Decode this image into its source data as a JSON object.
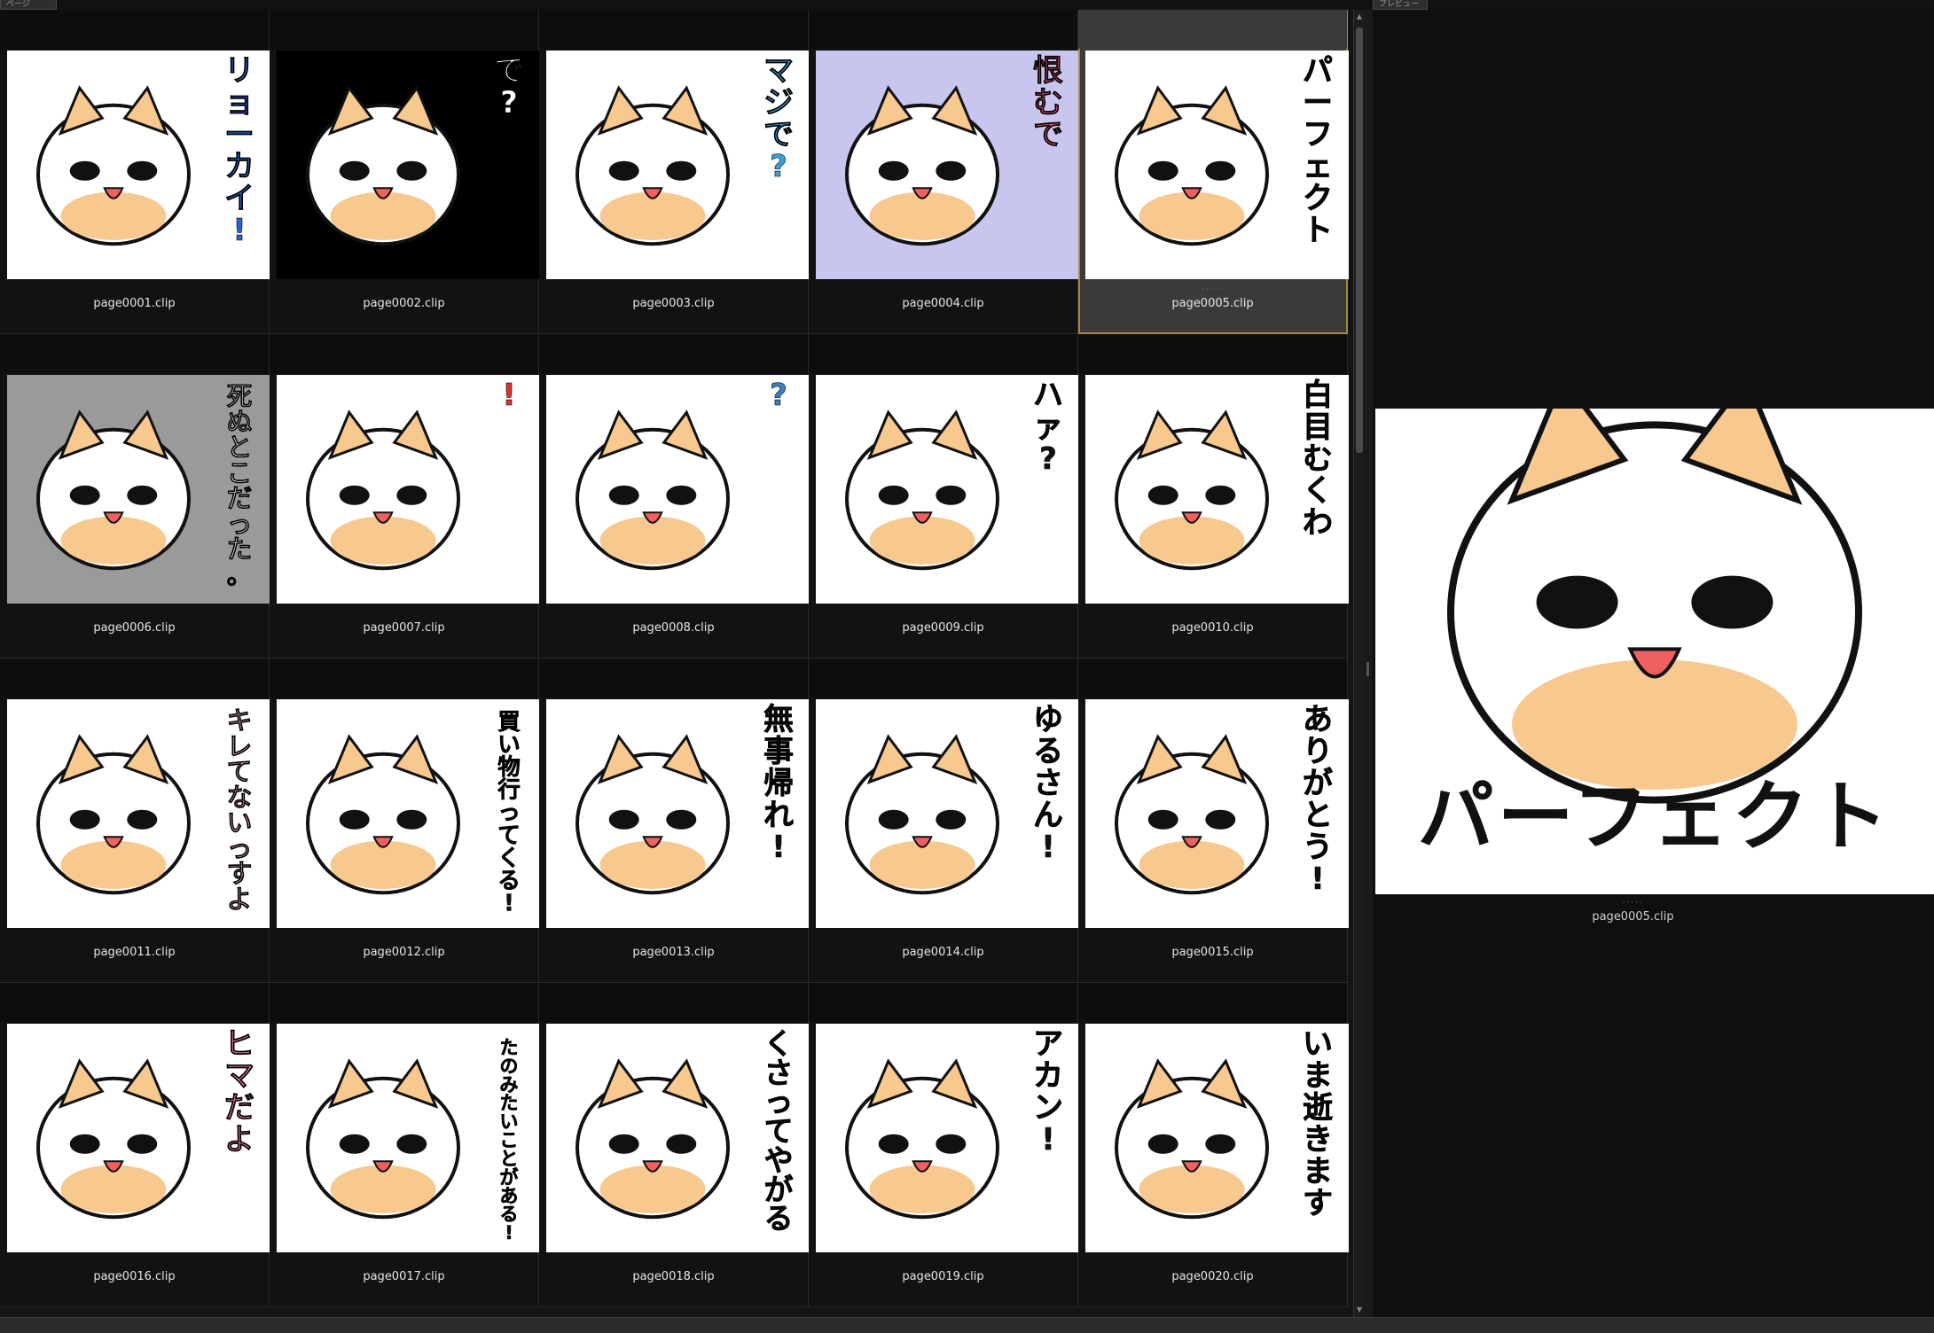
{
  "tabs": {
    "pages": "ページ",
    "preview": "プレビュー"
  },
  "selected_page": "page0005.clip",
  "pages": [
    {
      "file": "page0001.clip",
      "text": "リョーカイ!",
      "bg": "#ffffff",
      "fg": "#2e5fd8"
    },
    {
      "file": "page0002.clip",
      "text": "で?",
      "bg": "#000000",
      "fg": "#ffffff"
    },
    {
      "file": "page0003.clip",
      "text": "マジで?",
      "bg": "#ffffff",
      "fg": "#3a9fd6"
    },
    {
      "file": "page0004.clip",
      "text": "恨むで",
      "bg": "#c8c6ef",
      "fg": "#e0577a"
    },
    {
      "file": "page0005.clip",
      "text": "パーフェクト",
      "bg": "#ffffff",
      "fg": "#111111"
    },
    {
      "file": "page0006.clip",
      "text": "死ぬとこだった。",
      "bg": "#9a9a9a",
      "fg": "#ffffff"
    },
    {
      "file": "page0007.clip",
      "text": "!",
      "bg": "#ffffff",
      "fg": "#e23030"
    },
    {
      "file": "page0008.clip",
      "text": "?",
      "bg": "#ffffff",
      "fg": "#3d7fb6"
    },
    {
      "file": "page0009.clip",
      "text": "ハァ?",
      "bg": "#ffffff",
      "fg": "#111111"
    },
    {
      "file": "page0010.clip",
      "text": "白目むくわ",
      "bg": "#ffffff",
      "fg": "#111111"
    },
    {
      "file": "page0011.clip",
      "text": "キレてないっすよ",
      "bg": "#ffffff",
      "fg": "#e7a7b4"
    },
    {
      "file": "page0012.clip",
      "text": "買い物行ってくる!",
      "bg": "#ffffff",
      "fg": "#111111"
    },
    {
      "file": "page0013.clip",
      "text": "無事帰れ!",
      "bg": "#ffffff",
      "fg": "#111111"
    },
    {
      "file": "page0014.clip",
      "text": "ゆるさん!",
      "bg": "#ffffff",
      "fg": "#111111"
    },
    {
      "file": "page0015.clip",
      "text": "ありがとう!",
      "bg": "#ffffff",
      "fg": "#111111"
    },
    {
      "file": "page0016.clip",
      "text": "ヒマだよ",
      "bg": "#ffffff",
      "fg": "#ef7aa0"
    },
    {
      "file": "page0017.clip",
      "text": "たのみたいことがある!",
      "bg": "#ffffff",
      "fg": "#111111"
    },
    {
      "file": "page0018.clip",
      "text": "くさってやがる",
      "bg": "#ffffff",
      "fg": "#111111"
    },
    {
      "file": "page0019.clip",
      "text": "アカン!",
      "bg": "#ffffff",
      "fg": "#111111"
    },
    {
      "file": "page0020.clip",
      "text": "いま逝きます",
      "bg": "#ffffff",
      "fg": "#111111"
    }
  ],
  "preview": {
    "file": "page0005.clip",
    "text": "パーフェクト"
  },
  "colors": {
    "cat_orange": "#f7c98f",
    "cat_pink": "#f6a9b0",
    "selected_border": "#a68a3a"
  }
}
